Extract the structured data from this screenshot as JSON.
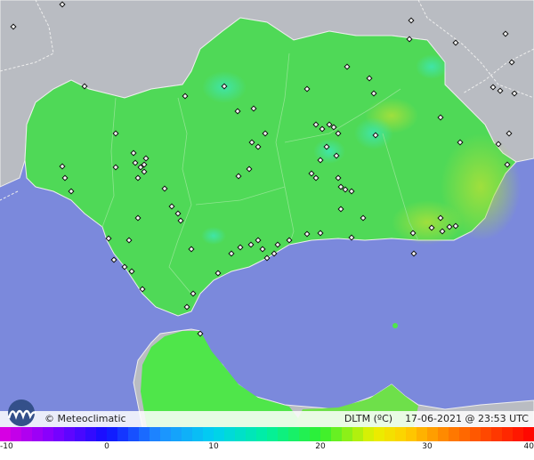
{
  "map": {
    "colors": {
      "sea": "#7b89dc",
      "land_foreign": "#b9bcc2",
      "land_main": "#4fd957",
      "land_africa": "#4fe64a",
      "border": "#eeeeee",
      "province_line": "#8ee58f",
      "station": "#111111"
    },
    "icons": [
      "station-marker-icon",
      "meteoclimatic-logo-icon"
    ]
  },
  "footer": {
    "credit": "© Meteoclimatic",
    "variable": "DLTM (ºC)",
    "date": "17-06-2021 @ 23:53 UTC"
  },
  "legend": {
    "min": -10,
    "max": 40,
    "ticks": [
      "-10",
      "0",
      "10",
      "20",
      "30",
      "40"
    ],
    "gradient_stops": [
      {
        "value": -10,
        "color": "#e000e0"
      },
      {
        "value": -5,
        "color": "#8000ff"
      },
      {
        "value": 0,
        "color": "#1010ff"
      },
      {
        "value": 5,
        "color": "#1e90ff"
      },
      {
        "value": 10,
        "color": "#00d0f0"
      },
      {
        "value": 15,
        "color": "#00f0a0"
      },
      {
        "value": 20,
        "color": "#30f030"
      },
      {
        "value": 25,
        "color": "#e8f000"
      },
      {
        "value": 28,
        "color": "#ffd000"
      },
      {
        "value": 32,
        "color": "#ff8000"
      },
      {
        "value": 40,
        "color": "#ff0000"
      }
    ]
  }
}
